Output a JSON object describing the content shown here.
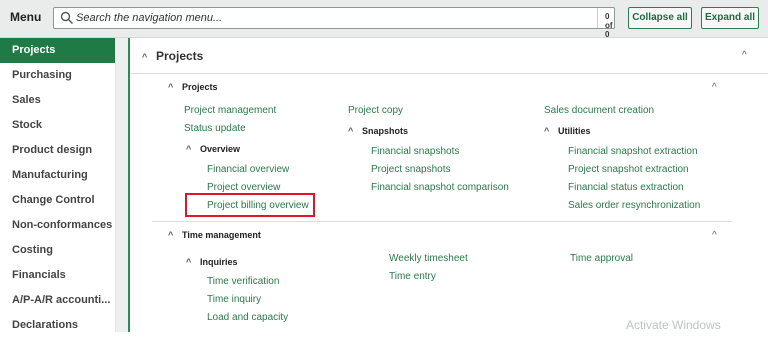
{
  "header": {
    "menu_label": "Menu",
    "search_placeholder": "Search the navigation menu...",
    "search_count": "0 of 0",
    "collapse_all": "Collapse all",
    "expand_all": "Expand all"
  },
  "sidebar": {
    "items": [
      {
        "label": "Projects",
        "active": true
      },
      {
        "label": "Purchasing"
      },
      {
        "label": "Sales"
      },
      {
        "label": "Stock"
      },
      {
        "label": "Product design"
      },
      {
        "label": "Manufacturing"
      },
      {
        "label": "Change Control"
      },
      {
        "label": "Non-conformances"
      },
      {
        "label": "Costing"
      },
      {
        "label": "Financials"
      },
      {
        "label": "A/P-A/R accounti..."
      },
      {
        "label": "Declarations"
      }
    ]
  },
  "main": {
    "section_title": "Projects",
    "projects_group": {
      "title": "Projects",
      "col1": [
        "Project management",
        "Status update"
      ],
      "overview": {
        "title": "Overview",
        "links": [
          "Financial overview",
          "Project overview",
          "Project billing overview"
        ]
      },
      "col2_top": "Project copy",
      "snapshots": {
        "title": "Snapshots",
        "links": [
          "Financial snapshots",
          "Project snapshots",
          "Financial snapshot comparison"
        ]
      },
      "col3_top": "Sales document creation",
      "utilities": {
        "title": "Utilities",
        "links": [
          "Financial snapshot extraction",
          "Project snapshot extraction",
          "Financial status extraction",
          "Sales order resynchronization"
        ]
      }
    },
    "time_group": {
      "title": "Time management",
      "inquiries": {
        "title": "Inquiries",
        "links": [
          "Time verification",
          "Time inquiry",
          "Load and capacity"
        ]
      },
      "col2": [
        "Weekly timesheet",
        "Time entry"
      ],
      "col3": [
        "Time approval"
      ]
    }
  },
  "watermark": "Activate Windows",
  "colors": {
    "accent": "#1f7a45",
    "link": "#2b7a4b",
    "highlight": "#e0142b"
  }
}
